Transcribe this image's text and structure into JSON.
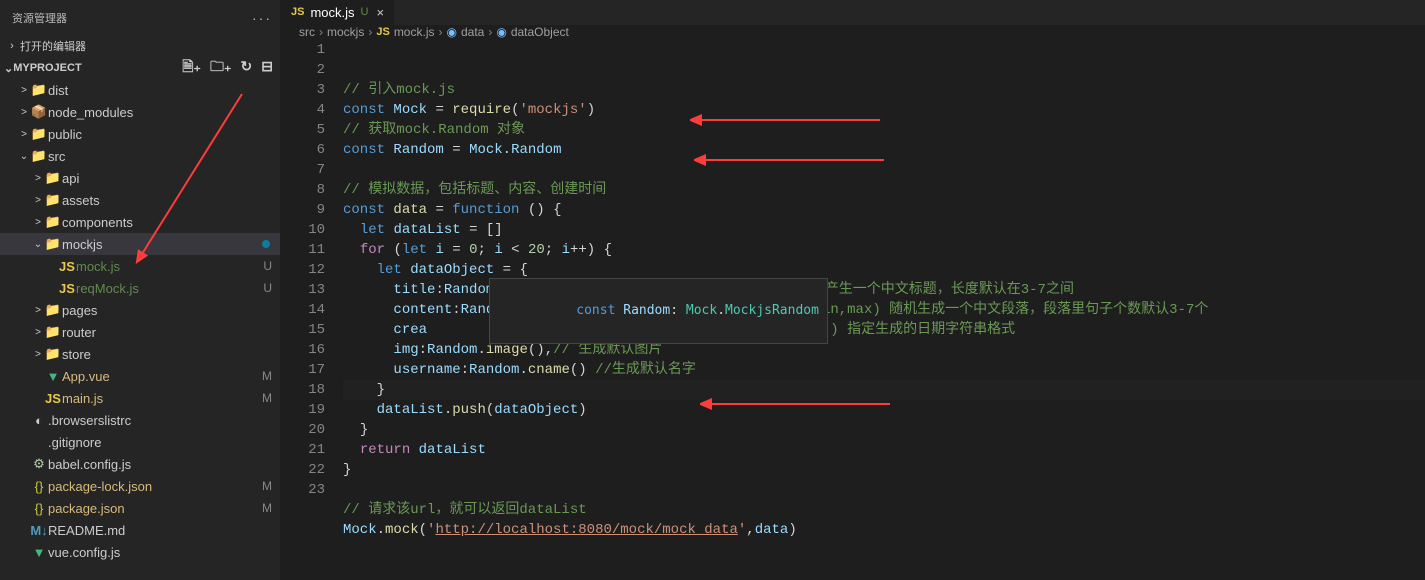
{
  "sidebar": {
    "title": "资源管理器",
    "open_editors": "打开的编辑器",
    "project": "MYPROJECT",
    "tree": [
      {
        "d": 1,
        "chev": ">",
        "ico": "📁",
        "ico_cls": "folder-y",
        "label": "dist"
      },
      {
        "d": 1,
        "chev": ">",
        "ico": "📦",
        "ico_cls": "folder-g",
        "label": "node_modules"
      },
      {
        "d": 1,
        "chev": ">",
        "ico": "📁",
        "ico_cls": "folder-y",
        "label": "public"
      },
      {
        "d": 1,
        "chev": "⌄",
        "ico": "📁",
        "ico_cls": "folder-g",
        "label": "src"
      },
      {
        "d": 2,
        "chev": ">",
        "ico": "📁",
        "ico_cls": "folder-y",
        "label": "api"
      },
      {
        "d": 2,
        "chev": ">",
        "ico": "📁",
        "ico_cls": "folder-r",
        "label": "assets"
      },
      {
        "d": 2,
        "chev": ">",
        "ico": "📁",
        "ico_cls": "folder-y",
        "label": "components"
      },
      {
        "d": 2,
        "chev": "⌄",
        "ico": "📁",
        "ico_cls": "folder-y",
        "label": "mockjs",
        "selected": true,
        "dot": true
      },
      {
        "d": 3,
        "chev": "",
        "ico": "JS",
        "ico_cls": "js-ico",
        "label": "mock.js",
        "badge": "U",
        "badge_cls": "untracked"
      },
      {
        "d": 3,
        "chev": "",
        "ico": "JS",
        "ico_cls": "js-ico",
        "label": "reqMock.js",
        "badge": "U",
        "badge_cls": "untracked"
      },
      {
        "d": 2,
        "chev": ">",
        "ico": "📁",
        "ico_cls": "folder-y",
        "label": "pages"
      },
      {
        "d": 2,
        "chev": ">",
        "ico": "📁",
        "ico_cls": "folder-y",
        "label": "router"
      },
      {
        "d": 2,
        "chev": ">",
        "ico": "📁",
        "ico_cls": "folder-y",
        "label": "store"
      },
      {
        "d": 2,
        "chev": "",
        "ico": "▼",
        "ico_cls": "vue-ico",
        "label": "App.vue",
        "badge": "M",
        "badge_cls": "modified"
      },
      {
        "d": 2,
        "chev": "",
        "ico": "JS",
        "ico_cls": "js-ico",
        "label": "main.js",
        "badge": "M",
        "badge_cls": "modified"
      },
      {
        "d": 1,
        "chev": "",
        "ico": "◐",
        "ico_cls": "",
        "label": ".browserslistrc"
      },
      {
        "d": 1,
        "chev": "",
        "ico": "",
        "ico_cls": "",
        "label": ".gitignore"
      },
      {
        "d": 1,
        "chev": "",
        "ico": "⚙",
        "ico_cls": "gear-ico",
        "label": "babel.config.js"
      },
      {
        "d": 1,
        "chev": "",
        "ico": "{}",
        "ico_cls": "json-ico",
        "label": "package-lock.json",
        "badge": "M",
        "badge_cls": "modified"
      },
      {
        "d": 1,
        "chev": "",
        "ico": "{}",
        "ico_cls": "json-ico",
        "label": "package.json",
        "badge": "M",
        "badge_cls": "modified"
      },
      {
        "d": 1,
        "chev": "",
        "ico": "M↓",
        "ico_cls": "md-ico",
        "label": "README.md"
      },
      {
        "d": 1,
        "chev": "",
        "ico": "▼",
        "ico_cls": "vue-ico",
        "label": "vue.config.js"
      }
    ]
  },
  "tab": {
    "icon": "JS",
    "name": "mock.js",
    "status": "U",
    "close": "×"
  },
  "breadcrumb": {
    "p1": "src",
    "p2": "mockjs",
    "p3": "mock.js",
    "p4": "data",
    "p5": "dataObject"
  },
  "hover": "const Random: Mock.MockjsRandom",
  "code_lines": 23
}
